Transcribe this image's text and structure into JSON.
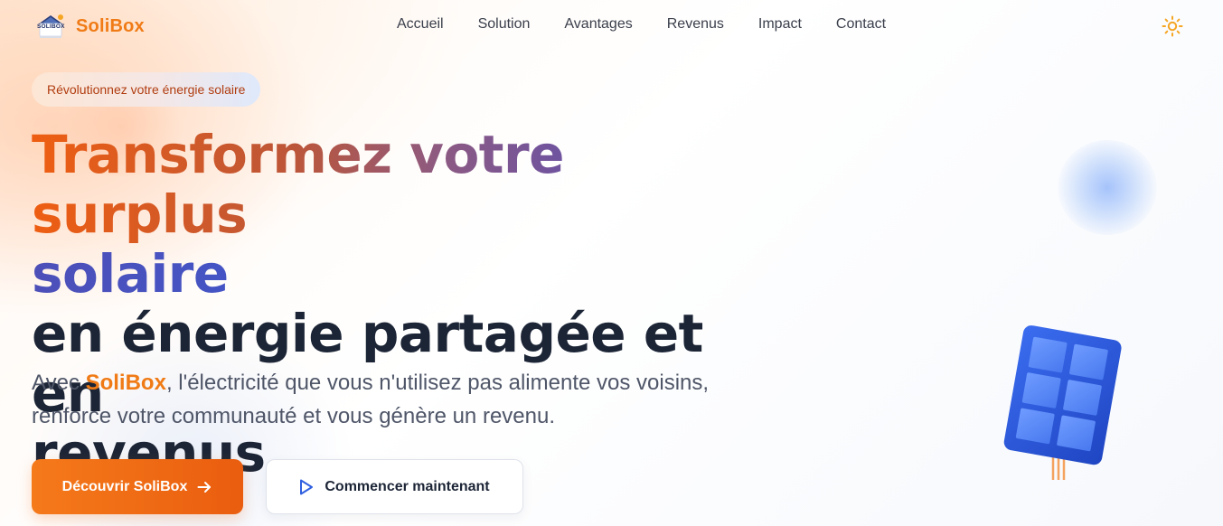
{
  "header": {
    "logo_text": "SOLIBOX",
    "brand": "SoliBox",
    "nav": [
      {
        "label": "Accueil"
      },
      {
        "label": "Solution"
      },
      {
        "label": "Avantages"
      },
      {
        "label": "Revenus"
      },
      {
        "label": "Impact"
      },
      {
        "label": "Contact"
      }
    ],
    "theme_toggle_icon": "sun-icon"
  },
  "hero": {
    "badge": "Révolutionnez votre énergie solaire",
    "headline": {
      "gradient_line1": "Transformez votre surplus",
      "gradient_line2": "solaire",
      "dark_line1": "en énergie partagée et en",
      "dark_line2": "revenus"
    },
    "subtitle": {
      "prefix": "Avec ",
      "brand": "SoliBox",
      "rest": ", l'électricité que vous n'utilisez pas alimente vos voisins, renforce votre communauté et vous génère un revenu."
    },
    "primary_button": {
      "label": "Découvrir SoliBox",
      "icon": "arrow-right-icon"
    },
    "secondary_button": {
      "label": "Commencer maintenant",
      "icon": "play-icon"
    }
  },
  "colors": {
    "brand_orange": "#f07b16",
    "gradient_start": "#ee5e12",
    "gradient_end": "#2f60e0",
    "dark_text": "#1c2536",
    "panel_blue": "#2d5fe0"
  }
}
